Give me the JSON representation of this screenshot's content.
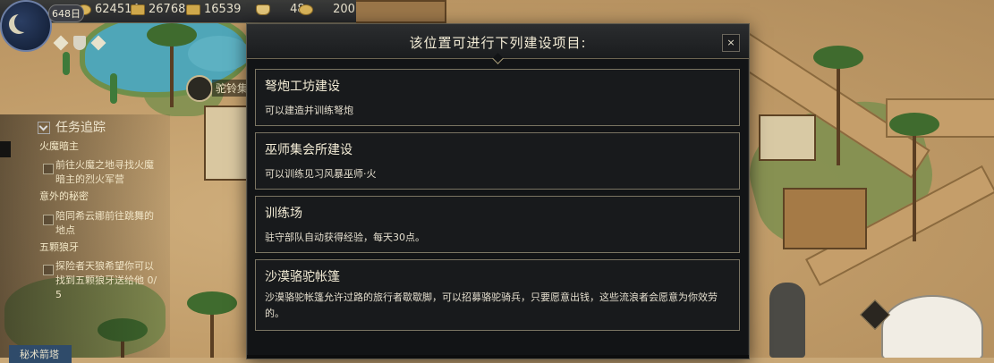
{
  "resources": {
    "day_badge": "648日",
    "gold": "624514",
    "food": "26768",
    "supplies": "16539",
    "population": "48",
    "reputation": "200"
  },
  "map": {
    "camp_label": "驼铃集"
  },
  "quest_tracker": {
    "title": "任务追踪",
    "tab_label": "秘术箭塔",
    "categories": [
      {
        "name": "火魔暗主",
        "tasks": [
          "前往火魔之地寻找火魔",
          "暗主的烈火军营"
        ]
      },
      {
        "name": "意外的秘密",
        "tasks": [
          "陪同希云娜前往跳舞的",
          "地点"
        ]
      },
      {
        "name": "五颗狼牙",
        "tasks": [
          "探险者天狼希望你可以",
          "找到五颗狼牙送给他 0/",
          "5"
        ]
      }
    ]
  },
  "dialog": {
    "title": "该位置可进行下列建设项目:",
    "close_label": "×",
    "items": [
      {
        "title": "弩炮工坊建设",
        "desc": "可以建造并训练弩炮"
      },
      {
        "title": "巫师集会所建设",
        "desc": "可以训练见习风暴巫师·火"
      },
      {
        "title": "训练场",
        "desc": "驻守部队自动获得经验，每天30点。"
      },
      {
        "title": "沙漠骆驼帐篷",
        "desc": "沙漠骆驼帐篷允许过路的旅行者歇歇脚，可以招募骆驼骑兵，只要愿意出钱，这些流浪者会愿意为你效劳的。"
      }
    ]
  },
  "colors": {
    "dialog_bg": "#121416",
    "item_border": "#7a7462",
    "text_light": "#f3ecd6"
  }
}
